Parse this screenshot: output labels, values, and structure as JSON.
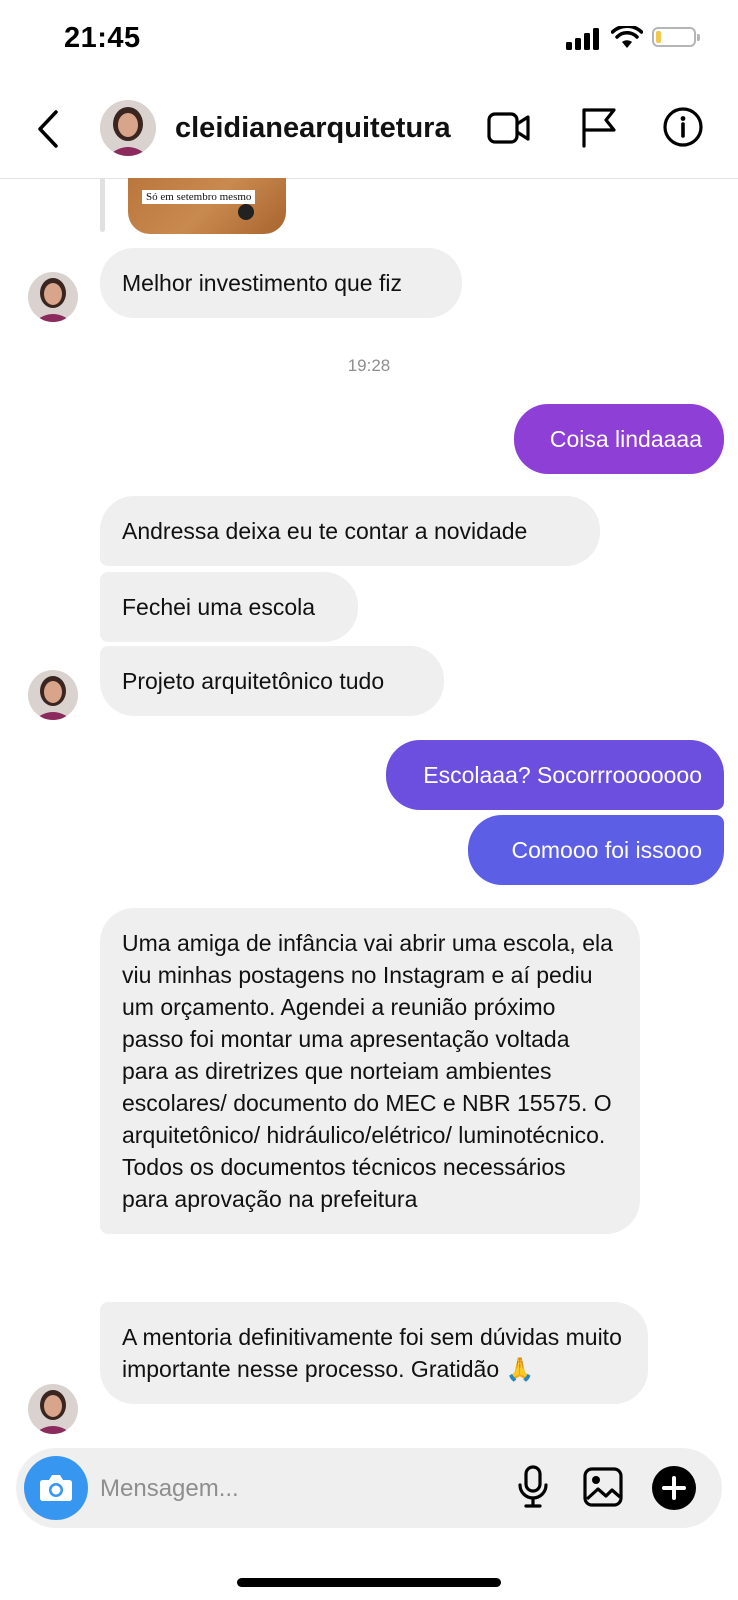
{
  "status_bar": {
    "time": "21:45"
  },
  "header": {
    "username": "cleidianearquitetura"
  },
  "image_preview": {
    "caption": "Só em setembro mesmo"
  },
  "messages": [
    {
      "side": "in",
      "text": "Melhor investimento que fiz"
    },
    {
      "side": "in",
      "text": "Andressa deixa eu te contar a novidade"
    },
    {
      "side": "in",
      "text": "Fechei uma escola"
    },
    {
      "side": "in",
      "text": "Projeto arquitetônico tudo"
    },
    {
      "side": "out",
      "text": "Coisa lindaaaa"
    },
    {
      "side": "out",
      "text": "Escolaaa? Socorrrooooooo"
    },
    {
      "side": "out",
      "text": "Comooo foi issooo"
    },
    {
      "side": "in",
      "text": "Uma amiga de infância vai abrir uma escola, ela viu minhas postagens no Instagram e aí pediu um orçamento. Agendei a reunião próximo passo foi montar uma apresentação voltada para as diretrizes que norteiam ambientes escolares/ documento do MEC e NBR 15575. O arquitetônico/ hidráulico/elétrico/ luminotécnico. Todos os documentos técnicos necessários para aprovação na prefeitura"
    },
    {
      "side": "in",
      "text": "A mentoria definitivamente foi sem dúvidas muito importante nesse processo. Gratidão 🙏"
    }
  ],
  "timestamp": "19:28",
  "composer": {
    "placeholder": "Mensagem..."
  },
  "colors": {
    "incoming_bubble": "#efefef",
    "outgoing_1": "#8e3fd6",
    "outgoing_2": "#6d4fe0",
    "outgoing_3": "#5d5ee6",
    "camera_button": "#3797f0"
  }
}
